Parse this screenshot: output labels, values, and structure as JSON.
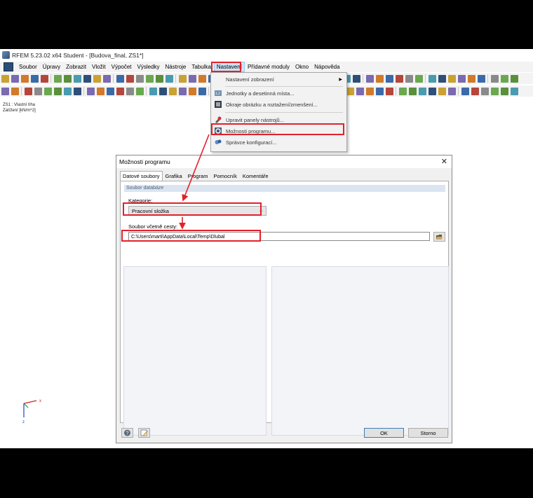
{
  "window": {
    "title": "RFEM 5.23.02 x64 Student - [Budova_final, ZS1*]"
  },
  "menubar": {
    "items": [
      "Soubor",
      "Úpravy",
      "Zobrazit",
      "Vložit",
      "Výpočet",
      "Výsledky",
      "Nástroje",
      "Tabulka",
      "Nastavení",
      "Přídavné moduly",
      "Okno",
      "Nápověda"
    ],
    "active": "Nastavení"
  },
  "viewport": {
    "info_line1": "ZS1 : Vlastní tíha",
    "info_line2": "Zatížení [kN/m^2]",
    "axis_x": "x",
    "axis_z": "z"
  },
  "settings_menu": {
    "items": [
      {
        "label": "Nastavení zobrazení",
        "icon": "display-settings-icon",
        "submenu": true
      },
      {
        "label": "Jednotky a desetinná místa...",
        "icon": "units-icon"
      },
      {
        "label": "Okraje obrázku a roztažení/zmenšení...",
        "icon": "image-margins-icon"
      },
      {
        "label": "Upravit panely nástrojů...",
        "icon": "toolbars-icon"
      },
      {
        "label": "Možnosti programu...",
        "icon": "program-options-icon",
        "highlighted": true
      },
      {
        "label": "Správce konfigurací...",
        "icon": "config-manager-icon"
      }
    ]
  },
  "dialog": {
    "title": "Možnosti programu",
    "tabs": [
      "Datové soubory",
      "Grafika",
      "Program",
      "Pomocník",
      "Komentáře"
    ],
    "active_tab": "Datové soubory",
    "group_title": "Soubor databáze",
    "category_label": "Kategorie:",
    "category_value": "Pracovní složka",
    "path_label": "Soubor včetně cesty:",
    "path_value": "C:\\Users\\marti\\AppData\\Local\\Temp\\Dlubal",
    "ok_label": "OK",
    "cancel_label": "Storno"
  },
  "colors": {
    "highlight": "#e3202b",
    "menu_active": "#cce4f7",
    "group_header": "#dbe5f1"
  }
}
